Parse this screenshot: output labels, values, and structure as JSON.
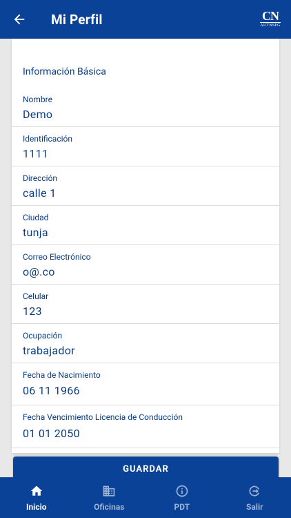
{
  "header": {
    "title": "Mi Perfil",
    "logo_mark": "CN",
    "logo_sub": "AUTNSEG"
  },
  "section_title": "Información Básica",
  "fields": [
    {
      "label": "Nombre",
      "value": "Demo"
    },
    {
      "label": "Identificación",
      "value": "1111"
    },
    {
      "label": "Dirección",
      "value": "calle 1"
    },
    {
      "label": "Ciudad",
      "value": "tunja"
    },
    {
      "label": "Correo Electrónico",
      "value": "o@.co"
    },
    {
      "label": "Celular",
      "value": "123"
    },
    {
      "label": "Ocupación",
      "value": "trabajador"
    },
    {
      "label": "Fecha de Nacimiento",
      "value": "06 11 1966"
    },
    {
      "label": "Fecha Vencimiento Licencia de Conducción",
      "value": "01 01 2050"
    }
  ],
  "save_label": "GUARDAR",
  "nav": [
    {
      "label": "Inicio",
      "icon": "home-icon",
      "active": true
    },
    {
      "label": "Oficinas",
      "icon": "building-icon",
      "active": false
    },
    {
      "label": "PDT",
      "icon": "info-icon",
      "active": false
    },
    {
      "label": "Salir",
      "icon": "logout-icon",
      "active": false
    }
  ],
  "colors": {
    "primary": "#0a4297",
    "text": "#0a3d82",
    "nav_inactive": "#9fb4d6"
  }
}
